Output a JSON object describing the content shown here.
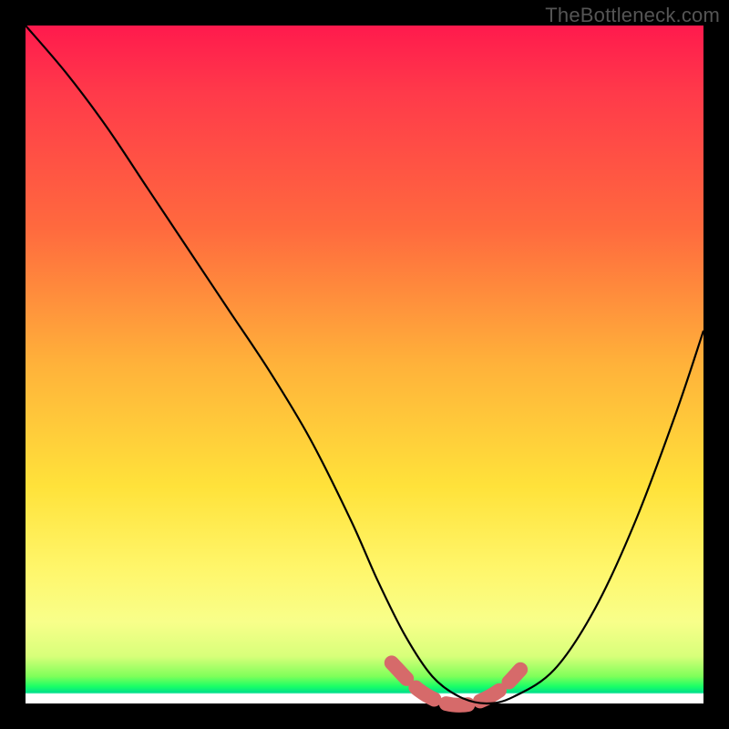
{
  "watermark": "TheBottleneck.com",
  "chart_data": {
    "type": "line",
    "title": "",
    "xlabel": "",
    "ylabel": "",
    "xlim": [
      0,
      100
    ],
    "ylim": [
      0,
      100
    ],
    "series": [
      {
        "name": "bottleneck-curve",
        "x": [
          0,
          6,
          12,
          18,
          24,
          30,
          36,
          42,
          48,
          52,
          56,
          60,
          64,
          68,
          72,
          78,
          84,
          90,
          96,
          100
        ],
        "y": [
          100,
          93,
          85,
          76,
          67,
          58,
          49,
          39,
          27,
          18,
          10,
          4,
          1,
          0,
          1,
          5,
          14,
          27,
          43,
          55
        ]
      }
    ],
    "highlight": {
      "name": "optimal-range",
      "x": [
        54,
        58,
        62,
        66,
        70,
        73
      ],
      "y": [
        6,
        2,
        0,
        0,
        2,
        5
      ]
    },
    "background_gradient": {
      "top": "#ff1a4d",
      "mid": "#ffe23a",
      "bottom_band": "#1aff66"
    }
  }
}
